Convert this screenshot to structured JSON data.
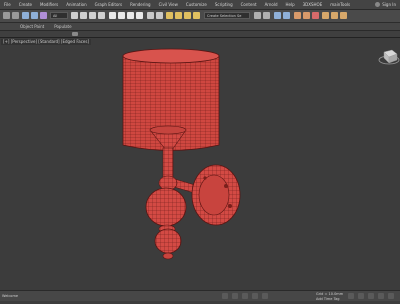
{
  "menu": {
    "items": [
      "File",
      "Create",
      "Modifiers",
      "Animation",
      "Graph Editors",
      "Rendering",
      "Civil View",
      "Customize",
      "Scripting",
      "Content",
      "Arnold",
      "Help",
      "3DXSHOE",
      "mainTools"
    ],
    "sign_in": "Sign In"
  },
  "toolbar": {
    "view_dropdown": "All",
    "selection_set_placeholder": "Create Selection Se"
  },
  "ribbon": {
    "items": [
      "Object Paint",
      "Populate"
    ]
  },
  "viewport": {
    "label": "[+] [Perspective] [Standard] [Edged Faces]",
    "mesh_color": "#d34a44",
    "edge_color": "#6a1a17"
  },
  "status": {
    "left_text": "Welcome",
    "grid_text": "Grid = 10.0mm",
    "time_tag_text": "Add Time Tag"
  }
}
